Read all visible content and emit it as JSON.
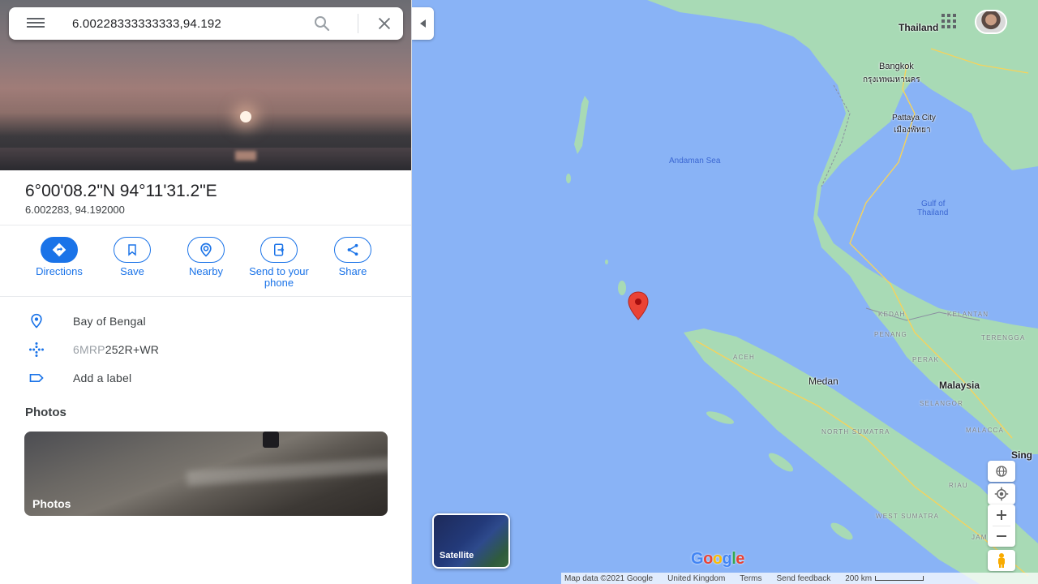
{
  "search": {
    "value": "6.00228333333333,94.192",
    "menu_icon": "hamburger-menu-icon",
    "search_icon": "search-icon",
    "close_icon": "close-icon"
  },
  "place": {
    "title": "6°00'08.2\"N 94°11'31.2\"E",
    "subtitle": "6.002283, 94.192000"
  },
  "actions": [
    {
      "label": "Directions",
      "icon": "directions-icon"
    },
    {
      "label": "Save",
      "icon": "bookmark-icon"
    },
    {
      "label": "Nearby",
      "icon": "nearby-icon"
    },
    {
      "label": "Send to your phone",
      "icon": "send-to-phone-icon"
    },
    {
      "label": "Share",
      "icon": "share-icon"
    }
  ],
  "info": {
    "location": "Bay of Bengal",
    "plus_code_prefix": "6MRP",
    "plus_code_suffix": "252R+WR",
    "label_action": "Add a label"
  },
  "photos": {
    "heading": "Photos",
    "card_label": "Photos"
  },
  "map": {
    "labels": {
      "thailand": "Thailand",
      "bangkok": "Bangkok",
      "bangkok_thai": "กรุงเทพมหานคร",
      "pattaya": "Pattaya City",
      "pattaya_thai": "เมืองพัทยา",
      "andaman_sea": "Andaman Sea",
      "gulf_line1": "Gulf of",
      "gulf_line2": "Thailand",
      "kedah": "KEDAH",
      "kelantan": "KELANTAN",
      "penang": "PENANG",
      "terengganu": "TERENGGA",
      "perak": "PERAK",
      "aceh": "ACEH",
      "medan": "Medan",
      "malaysia": "Malaysia",
      "selangor": "SELANGOR",
      "north_sumatra": "NORTH SUMATRA",
      "malacca": "MALACCA",
      "sing": "Sing",
      "riau": "RIAU",
      "west_sumatra": "WEST SUMATRA",
      "jam": "JAM"
    },
    "satellite_label": "Satellite",
    "google_logo": [
      "G",
      "o",
      "o",
      "g",
      "l",
      "e"
    ],
    "logo_colors": [
      "#4285F4",
      "#EA4335",
      "#FBBC05",
      "#4285F4",
      "#34A853",
      "#EA4335"
    ],
    "footer": {
      "data": "Map data ©2021 Google",
      "region": "United Kingdom",
      "terms": "Terms",
      "feedback": "Send feedback",
      "scale": "200 km"
    },
    "pin_color": "#EA4335",
    "water_color": "#89b3f6",
    "land_color": "#a8dab5"
  },
  "colors": {
    "accent": "#1a73e8"
  }
}
